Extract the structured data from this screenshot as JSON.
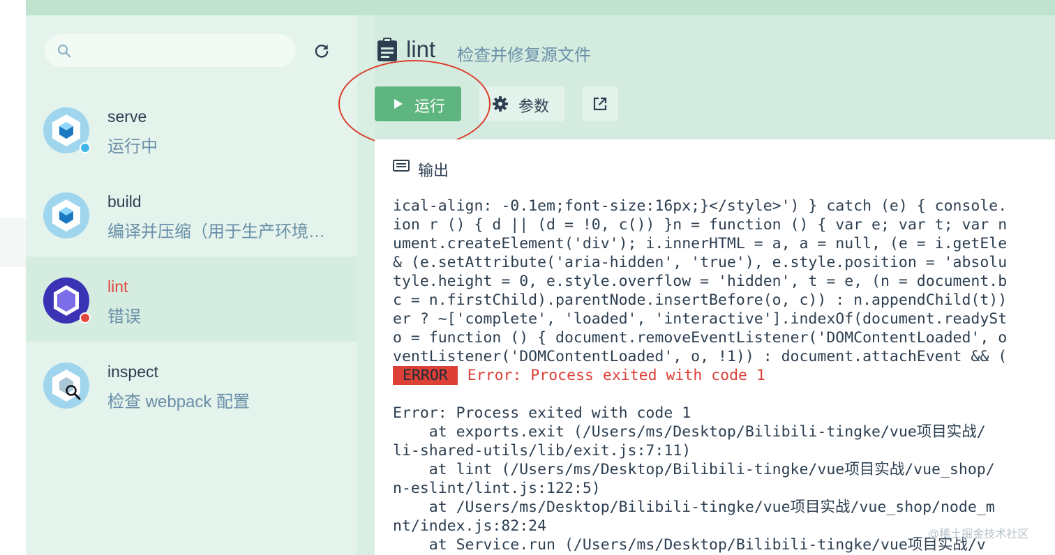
{
  "search": {
    "placeholder": ""
  },
  "tasks": [
    {
      "name": "serve",
      "desc": "运行中",
      "status": "running"
    },
    {
      "name": "build",
      "desc": "编译并压缩（用于生产环境…",
      "status": "idle"
    },
    {
      "name": "lint",
      "desc": "错误",
      "status": "error"
    },
    {
      "name": "inspect",
      "desc": "检查 webpack 配置",
      "status": "idle"
    }
  ],
  "header": {
    "title": "lint",
    "subtitle": "检查并修复源文件"
  },
  "toolbar": {
    "run_label": "运行",
    "params_label": "参数"
  },
  "output": {
    "title": "输出",
    "lines": [
      "ical-align: -0.1em;font-size:16px;}</style>') } catch (e) { console.",
      "ion r () { d || (d = !0, c()) }n = function () { var e; var t; var n",
      "ument.createElement('div'); i.innerHTML = a, a = null, (e = i.getEle",
      "& (e.setAttribute('aria-hidden', 'true'), e.style.position = 'absolu",
      "tyle.height = 0, e.style.overflow = 'hidden', t = e, (n = document.b",
      "c = n.firstChild).parentNode.insertBefore(o, c)) : n.appendChild(t))",
      "er ? ~['complete', 'loaded', 'interactive'].indexOf(document.readySt",
      "o = function () { document.removeEventListener('DOMContentLoaded', o",
      "ventListener('DOMContentLoaded', o, !1)) : document.attachEvent && (",
      "",
      "",
      "Error: Process exited with code 1",
      "    at exports.exit (/Users/ms/Desktop/Bilibili-tingke/vue项目实战/",
      "li-shared-utils/lib/exit.js:7:11)",
      "    at lint (/Users/ms/Desktop/Bilibili-tingke/vue项目实战/vue_shop/",
      "n-eslint/lint.js:122:5)",
      "    at /Users/ms/Desktop/Bilibili-tingke/vue项目实战/vue_shop/node_m",
      "nt/index.js:82:24",
      "    at Service.run (/Users/ms/Desktop/Bilibili-tingke/vue项目实战/v"
    ],
    "error_badge": "ERROR",
    "error_message": "Error: Process exited with code 1"
  },
  "watermark": "@稀土掘金技术社区",
  "colors": {
    "accent": "#5fb57f",
    "error": "#dc4037",
    "running": "#3fb6e6"
  }
}
